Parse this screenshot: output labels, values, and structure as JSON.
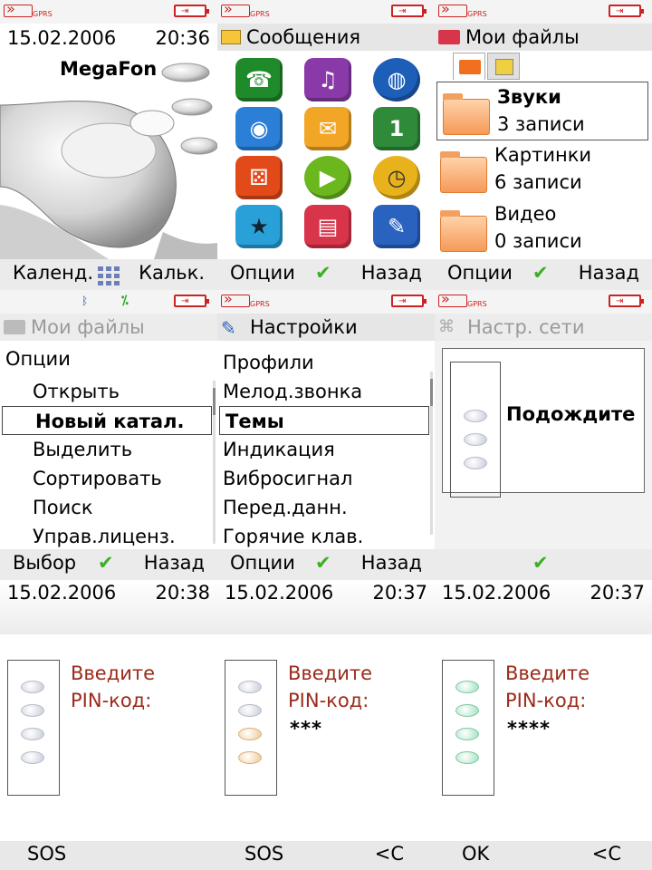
{
  "status": {
    "gprs_label": "GPRS"
  },
  "screens": {
    "standby": {
      "date": "15.02.2006",
      "time": "20:36",
      "operator": "MegaFon",
      "soft_left": "Календ.",
      "soft_right": "Кальк."
    },
    "menu": {
      "title": "Сообщения",
      "icons": [
        "phonebook-icon",
        "media-player-icon",
        "internet-icon",
        "camera-icon",
        "messages-icon",
        "calendar-icon",
        "games-icon",
        "play-icon",
        "alarm-icon",
        "entertainment-icon",
        "files-icon",
        "settings-icon"
      ],
      "soft_left": "Опции",
      "soft_right": "Назад"
    },
    "files": {
      "title": "Мои файлы",
      "items": [
        {
          "name": "Звуки",
          "count": "3 записи"
        },
        {
          "name": "Картинки",
          "count": "6 записи"
        },
        {
          "name": "Видео",
          "count": "0 записи"
        }
      ],
      "soft_left": "Опции",
      "soft_right": "Назад"
    },
    "files_options": {
      "title": "Мои файлы",
      "header": "Опции",
      "items": [
        "Открыть",
        "Новый катал.",
        "Выделить",
        "Сортировать",
        "Поиск",
        "Управ.лиценз."
      ],
      "selected_index": 1,
      "soft_left": "Выбор",
      "soft_right": "Назад"
    },
    "settings": {
      "title": "Настройки",
      "items": [
        "Профили",
        "Мелод.звонка",
        "Темы",
        "Индикация",
        "Вибросигнал",
        "Перед.данн.",
        "Горячие клав."
      ],
      "selected_index": 2,
      "soft_left": "Опции",
      "soft_right": "Назад"
    },
    "network": {
      "title": "Настр. сети",
      "wait_text": "Подождите"
    },
    "pin1": {
      "date": "15.02.2006",
      "time": "20:38",
      "prompt_line1": "Введите",
      "prompt_line2": "PIN-код:",
      "value": "",
      "soft_left": "SOS",
      "soft_right": ""
    },
    "pin2": {
      "date": "15.02.2006",
      "time": "20:37",
      "prompt_line1": "Введите",
      "prompt_line2": "PIN-код:",
      "value": "***",
      "soft_left": "SOS",
      "soft_right": "<C"
    },
    "pin3": {
      "date": "15.02.2006",
      "time": "20:37",
      "prompt_line1": "Введите",
      "prompt_line2": "PIN-код:",
      "value": "****",
      "soft_left": "OK",
      "soft_right": "<C"
    }
  },
  "colors": {
    "accent_red": "#c22222",
    "prompt_red": "#9b2a1a",
    "check_green": "#3cb024"
  }
}
